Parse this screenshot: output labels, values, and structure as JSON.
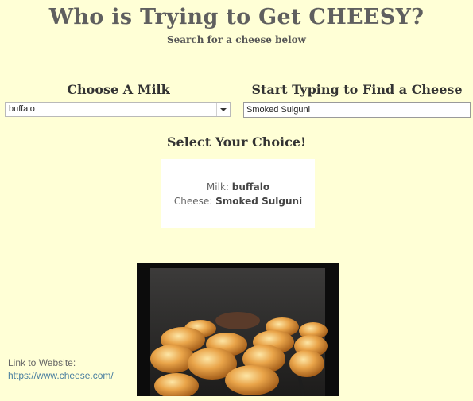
{
  "header": {
    "title": "Who is Trying to Get CHEESY?",
    "subtitle": "Search for a cheese below"
  },
  "milk": {
    "label": "Choose A Milk",
    "selected": "buffalo"
  },
  "cheese_search": {
    "label": "Start Typing to Find a Cheese",
    "value": "Smoked Sulguni"
  },
  "choice": {
    "label": "Select Your Choice!",
    "milk_prefix": "Milk:",
    "milk_value": "buffalo",
    "cheese_prefix": "Cheese:",
    "cheese_value": "Smoked Sulguni"
  },
  "footer": {
    "link_label": "Link to Website:",
    "link_url": "https://www.cheese.com/"
  },
  "colors": {
    "background": "#ffffd6",
    "title": "#5f5f5f",
    "link": "#4a7fa0"
  },
  "icons": {
    "dropdown": "chevron-down-icon"
  }
}
